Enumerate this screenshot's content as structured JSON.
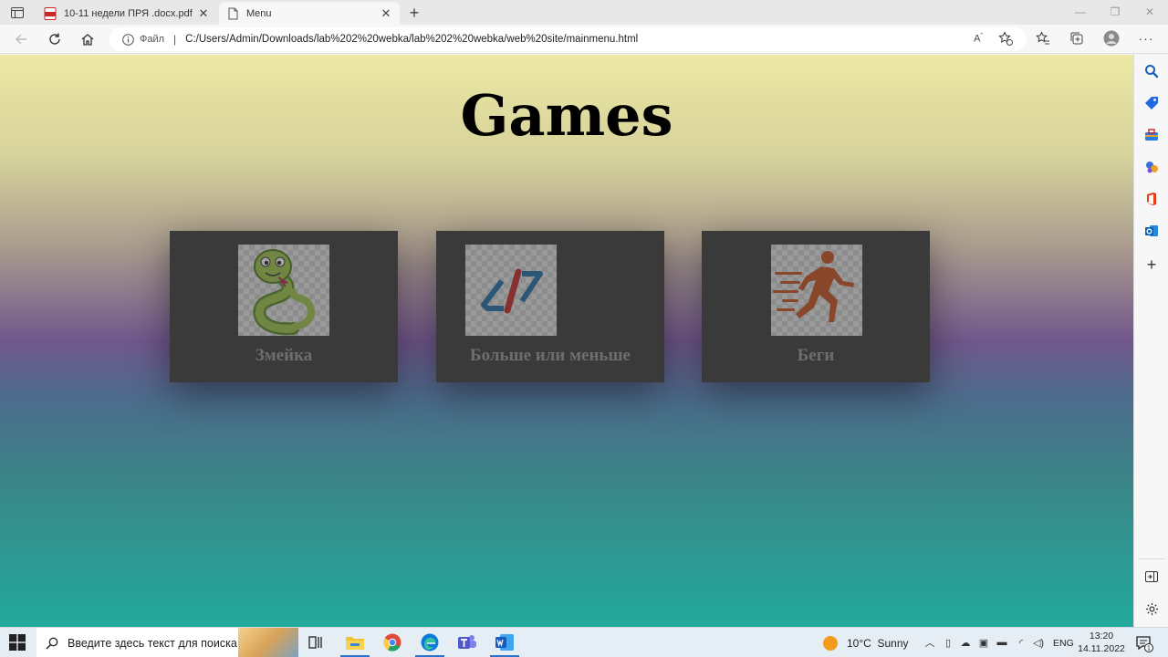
{
  "browser": {
    "tabs": [
      {
        "title": "10-11 недели ПРЯ .docx.pdf",
        "active": false
      },
      {
        "title": "Menu",
        "active": true
      }
    ],
    "address": {
      "scheme_label": "Файл",
      "url": "C:/Users/Admin/Downloads/lab%202%20webka/lab%202%20webka/web%20site/mainmenu.html"
    }
  },
  "page": {
    "title": "Games",
    "cards": [
      {
        "label": "Змейка",
        "icon": "snake-icon"
      },
      {
        "label": "Больше или меньше",
        "icon": "code-brackets-icon"
      },
      {
        "label": "Беги",
        "icon": "runner-icon"
      }
    ]
  },
  "taskbar": {
    "search_placeholder": "Введите здесь текст для поиска",
    "weather": {
      "temp": "10°C",
      "condition": "Sunny"
    },
    "language": "ENG",
    "time": "13:20",
    "date": "14.11.2022",
    "notification_count": "1"
  },
  "colors": {
    "card_bg": "#3a3a3a",
    "card_label": "#6e6e6e",
    "gradient_top": "#ece8a4",
    "gradient_mid": "#71578c",
    "gradient_bottom": "#22aa9c"
  }
}
